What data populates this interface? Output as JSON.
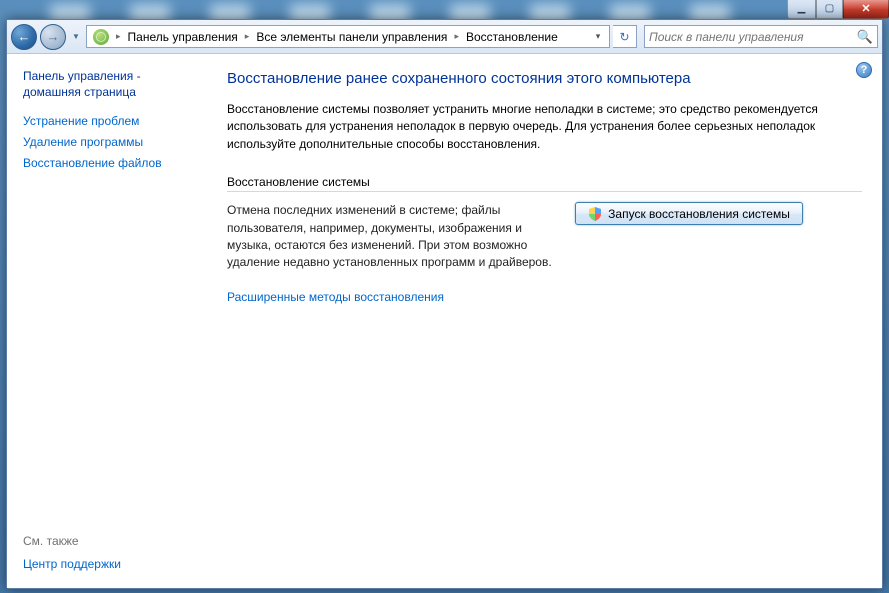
{
  "breadcrumb": {
    "seg1": "Панель управления",
    "seg2": "Все элементы панели управления",
    "seg3": "Восстановление"
  },
  "search": {
    "placeholder": "Поиск в панели управления"
  },
  "sidebar": {
    "header": "Панель управления - домашняя страница",
    "links": [
      "Устранение проблем",
      "Удаление программы",
      "Восстановление файлов"
    ],
    "also_label": "См. также",
    "also_link": "Центр поддержки"
  },
  "content": {
    "title": "Восстановление ранее сохраненного состояния этого компьютера",
    "intro": "Восстановление системы позволяет устранить многие неполадки в системе; это средство рекомендуется использовать для устранения неполадок в первую очередь. Для устранения более серьезных неполадок используйте дополнительные способы восстановления.",
    "section_label": "Восстановление системы",
    "section_desc": "Отмена последних изменений в системе; файлы пользователя, например, документы, изображения и музыка, остаются без изменений. При этом возможно удаление недавно установленных программ и драйверов.",
    "button_label": "Запуск восстановления системы",
    "advanced_link": "Расширенные методы восстановления"
  }
}
